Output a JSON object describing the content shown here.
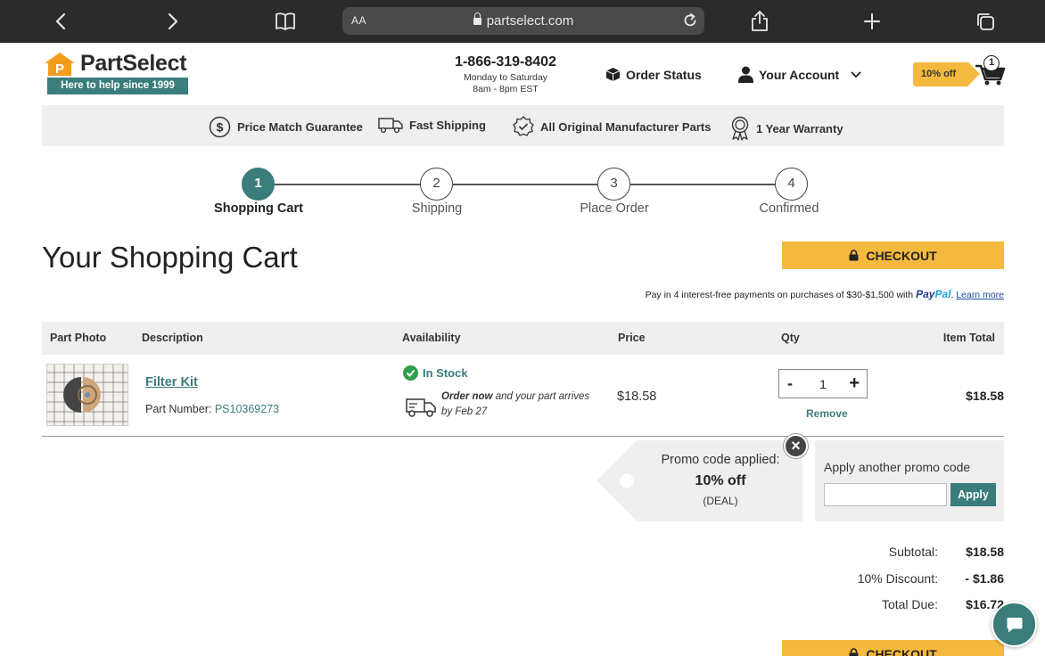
{
  "browser": {
    "text_size_label": "AA",
    "url": "partselect.com"
  },
  "header": {
    "logo_text": "PartSelect",
    "tagline": "Here to help since 1999",
    "phone": "1-866-319-8402",
    "hours_days": "Monday to Saturday",
    "hours_time": "8am - 8pm EST",
    "order_status": "Order Status",
    "your_account": "Your Account",
    "promo_badge": "10% off",
    "cart_count": "1"
  },
  "benefits": [
    {
      "label": "Price Match Guarantee",
      "icon": "dollar-circle-icon"
    },
    {
      "label": "Fast Shipping",
      "icon": "truck-icon"
    },
    {
      "label": "All Original Manufacturer Parts",
      "icon": "verified-badge-icon"
    },
    {
      "label": "1 Year Warranty",
      "icon": "ribbon-award-icon"
    }
  ],
  "steps": [
    {
      "number": "1",
      "label": "Shopping Cart",
      "active": true
    },
    {
      "number": "2",
      "label": "Shipping",
      "active": false
    },
    {
      "number": "3",
      "label": "Place Order",
      "active": false
    },
    {
      "number": "4",
      "label": "Confirmed",
      "active": false
    }
  ],
  "page": {
    "title": "Your Shopping Cart",
    "checkout_label": "CHECKOUT",
    "paypal_text": "Pay in 4 interest-free payments on purchases of $30-$1,500 with",
    "paypal_brand_1": "Pay",
    "paypal_brand_2": "Pal",
    "paypal_link": "Learn more"
  },
  "table": {
    "headers": {
      "photo": "Part Photo",
      "description": "Description",
      "availability": "Availability",
      "price": "Price",
      "qty": "Qty",
      "total": "Item Total"
    },
    "item": {
      "name": "Filter Kit",
      "part_number_label": "Part Number: ",
      "part_number": "PS10369273",
      "stock": "In Stock",
      "arrival_bold": "Order now",
      "arrival_rest": " and your part arrives",
      "arrival_date": "by Feb 27",
      "price": "$18.58",
      "qty": "1",
      "minus": "-",
      "plus": "+",
      "remove": "Remove",
      "total": "$18.58"
    }
  },
  "promo": {
    "applied_label": "Promo code applied:",
    "discount": "10% off",
    "code": "(DEAL)",
    "another_label": "Apply another promo code",
    "input_value": "",
    "apply_label": "Apply"
  },
  "totals": {
    "subtotal_label": "Subtotal:",
    "subtotal": "$18.58",
    "discount_label": "10% Discount:",
    "discount": "- $1.86",
    "total_label": "Total Due:",
    "total": "$16.72"
  },
  "colors": {
    "teal": "#3a7d7b",
    "gold": "#f4b93e",
    "logo_orange": "#f29b1d"
  }
}
